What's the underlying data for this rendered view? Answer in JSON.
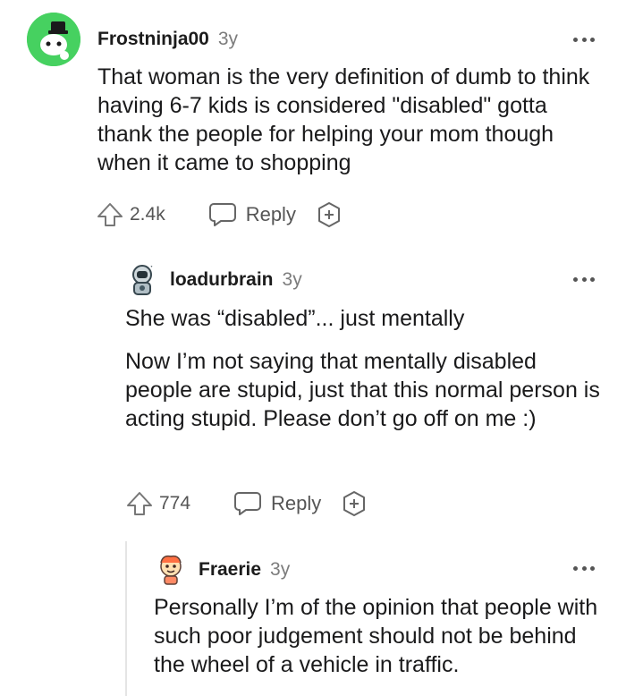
{
  "comments": [
    {
      "username": "Frostninja00",
      "age": "3y",
      "paragraphs": [
        "That woman is the very definition of dumb to think having 6-7 kids is considered \"disabled\" gotta thank the people for helping your mom though when it came to shopping"
      ],
      "votes": "2.4k",
      "reply_label": "Reply",
      "avatar_icon": "snoo-avatar-icon"
    },
    {
      "username": "loadurbrain",
      "age": "3y",
      "paragraphs": [
        "She was “disabled”... just mentally",
        "Now I’m not saying that mentally disabled people are stupid, just that this normal person is acting stupid. Please don’t go off on me :)"
      ],
      "votes": "774",
      "reply_label": "Reply",
      "avatar_icon": "astronaut-avatar-icon"
    },
    {
      "username": "Fraerie",
      "age": "3y",
      "paragraphs": [
        "Personally I’m of the opinion that people with such poor judgement should not be behind the wheel of a vehicle in traffic."
      ],
      "avatar_icon": "cartoon-avatar-icon"
    }
  ],
  "colors": {
    "accent_green": "#46d160",
    "muted": "#7c7c7c",
    "text": "#1a1a1b"
  }
}
